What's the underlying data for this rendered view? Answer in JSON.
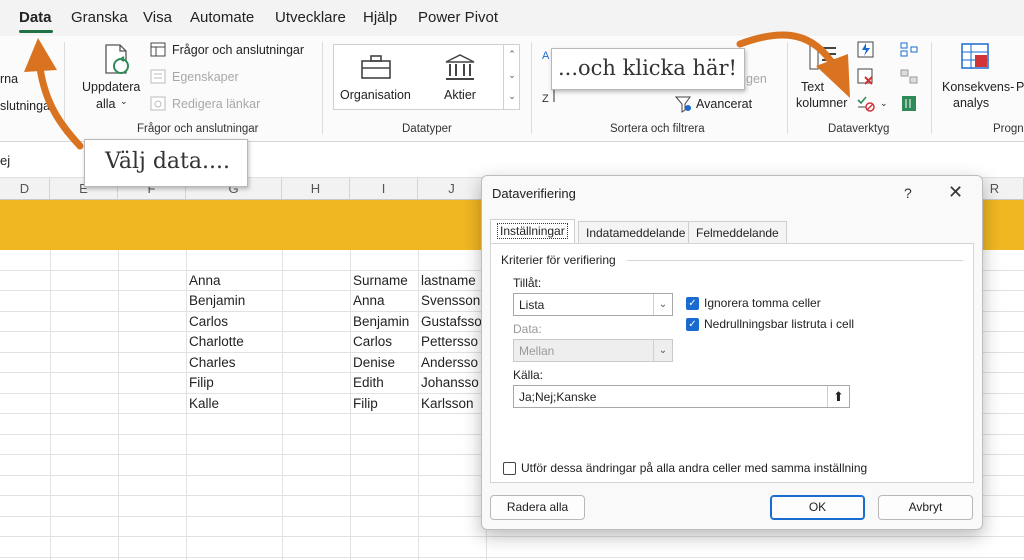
{
  "ribbon_tabs": [
    "Data",
    "Granska",
    "Visa",
    "Automate",
    "Utvecklare",
    "Hjälp",
    "Power Pivot"
  ],
  "ribbon": {
    "left_partial_1": "rna",
    "left_partial_2": "slutningar",
    "refresh_all_line1": "Uppdatera",
    "refresh_all_line2": "alla",
    "queries_connections": "Frågor och anslutningar",
    "properties": "Egenskaper",
    "edit_links": "Redigera länkar",
    "group_queries": "Frågor och anslutningar",
    "organisation": "Organisation",
    "stocks": "Aktier",
    "group_datatypes": "Datatyper",
    "sort_partial": "Sortera",
    "filter_partial": "Filtrera",
    "reapply_partial": "gen",
    "advanced": "Avancerat",
    "group_sort_filter": "Sortera och filtrera",
    "text_columns_line1": "Text",
    "text_columns_line2": "kolumner",
    "group_datatools": "Dataverktyg",
    "whatif_line1": "Konsekvens-",
    "whatif_line2": "analys",
    "forecast_partial": "P",
    "group_forecast_partial": "Progn"
  },
  "formula_bar_text": "ej",
  "columns": [
    "D",
    "E",
    "F",
    "G",
    "H",
    "I",
    "J",
    "R"
  ],
  "column_g": [
    "Anna",
    "Benjamin",
    "Carlos",
    "Charlotte",
    "Charles",
    "Filip",
    "Kalle"
  ],
  "column_i": [
    "Surname",
    "Anna",
    "Benjamin",
    "Carlos",
    "Denise",
    "Edith",
    "Filip"
  ],
  "column_j": [
    "lastname",
    "Svensson",
    "Gustafsso",
    "Pettersso",
    "Andersso",
    "Johansso",
    "Karlsson"
  ],
  "callouts": {
    "select_data": "Välj data....",
    "click_here": "...och klicka här!"
  },
  "dialog": {
    "title": "Dataverifiering",
    "help": "?",
    "close": "✕",
    "tabs": [
      "Inställningar",
      "Indatameddelande",
      "Felmeddelande"
    ],
    "criteria_label": "Kriterier för verifiering",
    "allow_label": "Tillåt:",
    "allow_value": "Lista",
    "ignore_blank": "Ignorera tomma celler",
    "incell_dropdown": "Nedrullningsbar listruta i cell",
    "data_label": "Data:",
    "data_value": "Mellan",
    "source_label": "Källa:",
    "source_value": "Ja;Nej;Kanske",
    "apply_all": "Utför dessa ändringar på alla andra celler med samma inställning",
    "clear_all": "Radera alla",
    "ok": "OK",
    "cancel": "Avbryt"
  },
  "colors": {
    "accent_green": "#1e7145",
    "band_yellow": "#f0b722",
    "arrow_orange": "#d9731f",
    "checkbox_blue": "#1a6bcf"
  }
}
